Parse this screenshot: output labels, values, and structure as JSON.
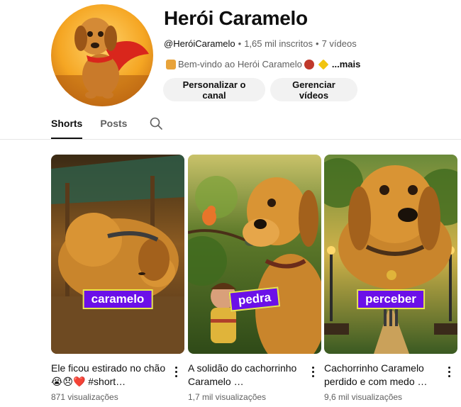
{
  "channel": {
    "name": "Herói Caramelo",
    "handle": "@HeróiCaramelo",
    "separator": "•",
    "subscribers": "1,65 mil inscritos",
    "video_count": "7 vídeos",
    "description": "Bem-vindo ao Herói Caramelo",
    "more_label": "...mais"
  },
  "buttons": {
    "customize": "Personalizar o canal",
    "manage": "Gerenciar vídeos"
  },
  "tabs": [
    {
      "label": "Shorts",
      "active": true
    },
    {
      "label": "Posts",
      "active": false
    }
  ],
  "icons": {
    "search": "search-icon",
    "more": "more-vert-icon"
  },
  "shorts": [
    {
      "caption": "caramelo",
      "title": "Ele ficou estirado no chão 😭😞❤️ #short…",
      "views": "871 visualizações"
    },
    {
      "caption": "pedra",
      "title": "A solidão do cachorrinho Caramelo …",
      "views": "1,7 mil visualizações"
    },
    {
      "caption": "perceber",
      "title": "Cachorrinho Caramelo perdido e com medo …",
      "views": "9,6 mil visualizações"
    }
  ],
  "colors": {
    "caption_bg": "#6b10e8",
    "caption_border": "#e8e84a",
    "button_bg": "#f2f2f2"
  }
}
